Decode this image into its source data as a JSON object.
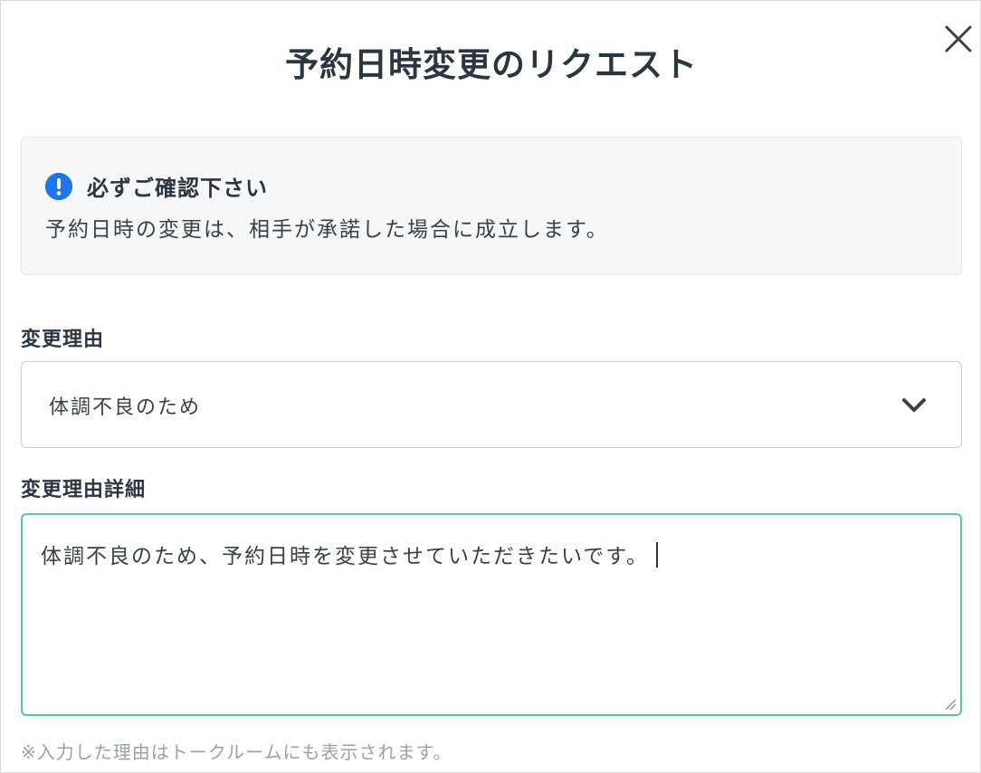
{
  "dialog": {
    "title": "予約日時変更のリクエスト",
    "close_icon": "close-icon"
  },
  "notice": {
    "icon": "alert-circle-icon",
    "title": "必ずご確認下さい",
    "body": "予約日時の変更は、相手が承諾した場合に成立します。"
  },
  "reason": {
    "label": "変更理由",
    "selected": "体調不良のため",
    "icon": "chevron-down-icon"
  },
  "detail": {
    "label": "変更理由詳細",
    "value": "体調不良のため、予約日時を変更させていただきたいです。"
  },
  "footnote": "※入力した理由はトークルームにも表示されます。",
  "colors": {
    "accent_border": "#5cc4b0",
    "alert_icon": "#1f76e6",
    "notice_bg": "#f5f7f8"
  }
}
